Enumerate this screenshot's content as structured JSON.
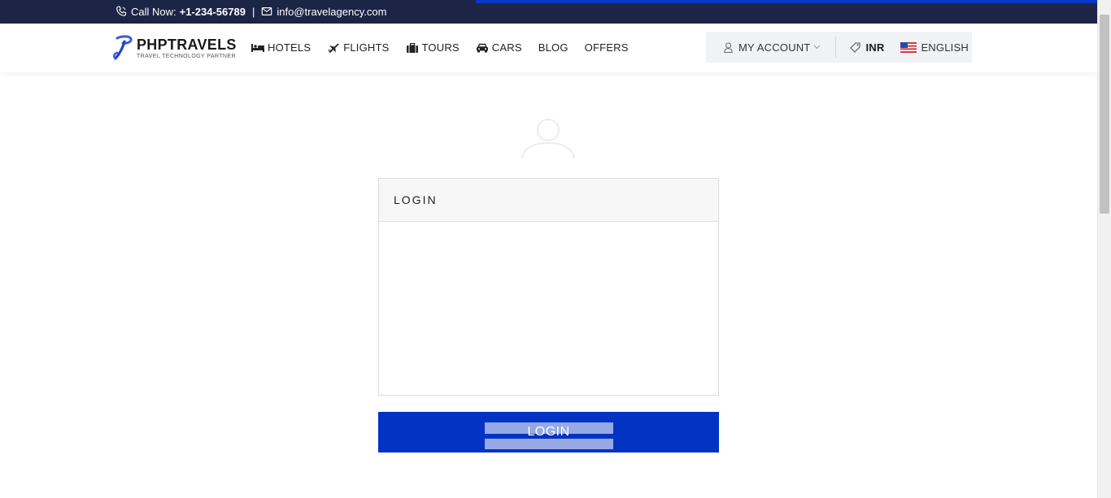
{
  "topbar": {
    "phone_label": "Call Now:",
    "phone_number": "+1-234-56789",
    "separator": "|",
    "email": "info@travelagency.com",
    "phone_icon": "phone-icon",
    "email_icon": "envelope-icon"
  },
  "header": {
    "logo_name": "PHPTRAVELS",
    "logo_tagline": "TRAVEL TECHNOLOGY PARTNER",
    "nav": [
      {
        "label": "HOTELS",
        "icon": "bed-icon"
      },
      {
        "label": "FLIGHTS",
        "icon": "plane-icon"
      },
      {
        "label": "TOURS",
        "icon": "suitcase-icon"
      },
      {
        "label": "CARS",
        "icon": "car-icon"
      },
      {
        "label": "BLOG"
      },
      {
        "label": "OFFERS"
      }
    ],
    "account_label": "MY ACCOUNT",
    "currency": "INR",
    "language": "ENGLISH"
  },
  "login": {
    "title": "LOGIN",
    "button_label": "LOGIN"
  },
  "colors": {
    "topbar_bg": "#1c2546",
    "brand_blue": "#0233c2",
    "accent_progress": "#0a35c8"
  }
}
